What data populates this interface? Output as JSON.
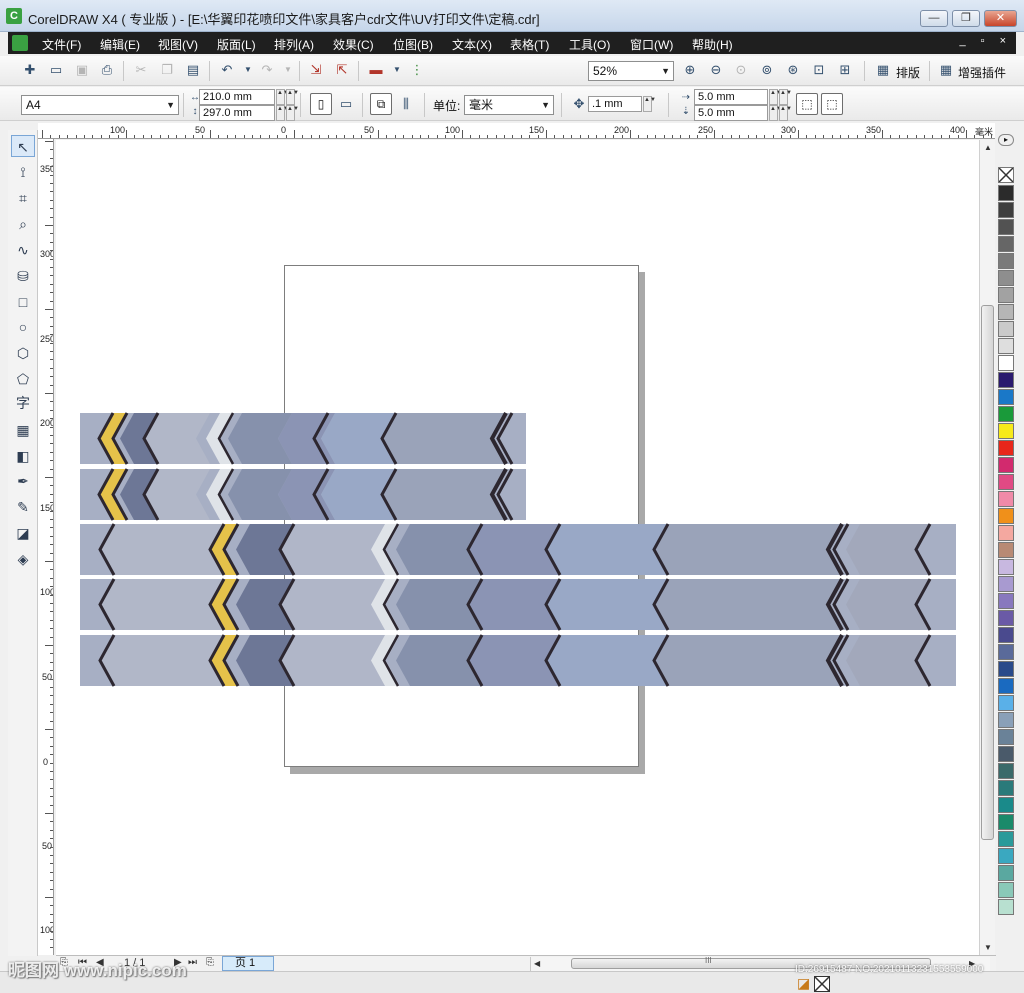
{
  "window": {
    "title": "CorelDRAW X4 ( 专业版 ) - [E:\\华翼印花喷印文件\\家具客户cdr文件\\UV打印文件\\定稿.cdr]",
    "minimize": "—",
    "maximize": "❐",
    "close": "✕"
  },
  "menu": {
    "items": [
      "文件(F)",
      "编辑(E)",
      "视图(V)",
      "版面(L)",
      "排列(A)",
      "效果(C)",
      "位图(B)",
      "文本(X)",
      "表格(T)",
      "工具(O)",
      "窗口(W)",
      "帮助(H)"
    ],
    "doc_controls": "_ ▫ ×"
  },
  "toolbar": {
    "zoom_value": "52%",
    "paiban_label": "排版",
    "plugin_label": "增强插件"
  },
  "property_bar": {
    "page_size": "A4",
    "width": "210.0 mm",
    "height": "297.0 mm",
    "unit_label": "单位:",
    "unit_value": "毫米",
    "nudge": ".1 mm",
    "dup_x": "5.0 mm",
    "dup_y": "5.0 mm"
  },
  "ruler": {
    "h_labels": [
      "100",
      "50",
      "0",
      "50",
      "100",
      "150",
      "200",
      "250",
      "300",
      "350",
      "400"
    ],
    "h_unit": "毫米",
    "v_labels": [
      "350",
      "300",
      "250",
      "200",
      "150",
      "100",
      "50",
      "0",
      "50",
      "100"
    ]
  },
  "status": {
    "page_counter": "1 / 1",
    "page_tab": "页 1",
    "hscroll_grip": "III"
  },
  "palette": {
    "colors": [
      "#2b2b2b",
      "#3e3e3e",
      "#525252",
      "#666666",
      "#7a7a7a",
      "#8e8e8e",
      "#a2a2a2",
      "#b6b6b6",
      "#cacaca",
      "#dedede",
      "#ffffff",
      "#2a1a6e",
      "#1a78c8",
      "#1a9a3a",
      "#f7ea1a",
      "#e8261a",
      "#d22a6e",
      "#e04a84",
      "#f08aa8",
      "#f0901a",
      "#f4a8a0",
      "#b88a74",
      "#c8b8e0",
      "#a89ad0",
      "#8878be",
      "#6a5aa6",
      "#4a4a8e",
      "#5a6a9a",
      "#2a4a8a",
      "#1a6ac0",
      "#5ab0e8",
      "#8aa0b8",
      "#6a8298",
      "#4a5a6a",
      "#3a6a6a",
      "#2a7a7a",
      "#1a8a8a",
      "#1a8a6a",
      "#2a9a9a",
      "#3aa8c0",
      "#5aa8a0",
      "#8ac8b8",
      "#b8e0d0"
    ]
  },
  "watermark": {
    "site": "昵图网 www.nipic.com",
    "id": "ID:26915487 NO:20210113231553559000"
  }
}
